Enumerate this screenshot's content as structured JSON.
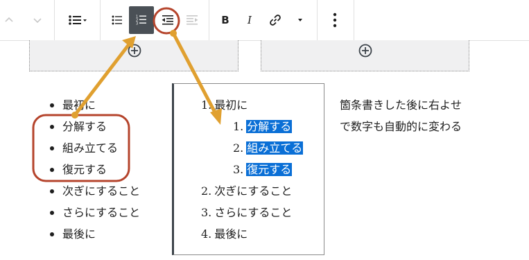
{
  "toolbar": {
    "move_up": "up-chevron",
    "move_down": "down-chevron",
    "list_style": "list",
    "unordered": "unordered-list",
    "ordered": "ordered-list",
    "outdent": "outdent",
    "indent": "indent",
    "bold_label": "B",
    "italic_label": "I",
    "link": "link",
    "more_rich": "dropdown",
    "more_options": "ellipsis"
  },
  "left_list": {
    "items": [
      "最初に",
      "分解する",
      "組み立てる",
      "復元する",
      "次ぎにすること",
      "さらにすること",
      "最後に"
    ]
  },
  "ordered_list": {
    "items": [
      {
        "num": "1.",
        "text": "最初に"
      },
      {
        "num": "2.",
        "text": "次ぎにすること"
      },
      {
        "num": "3.",
        "text": "さらにすること"
      },
      {
        "num": "4.",
        "text": "最後に"
      }
    ],
    "nested": [
      {
        "num": "1.",
        "text": "分解する"
      },
      {
        "num": "2.",
        "text": "組み立てる"
      },
      {
        "num": "3.",
        "text": "復元する"
      }
    ]
  },
  "note": "箇条書きした後に右よせで数字も自動的に変わる",
  "colors": {
    "accent_arrow": "#e0a030",
    "circle": "#b5442c",
    "selection": "#0a6fd6",
    "active_button": "#4a5056"
  }
}
